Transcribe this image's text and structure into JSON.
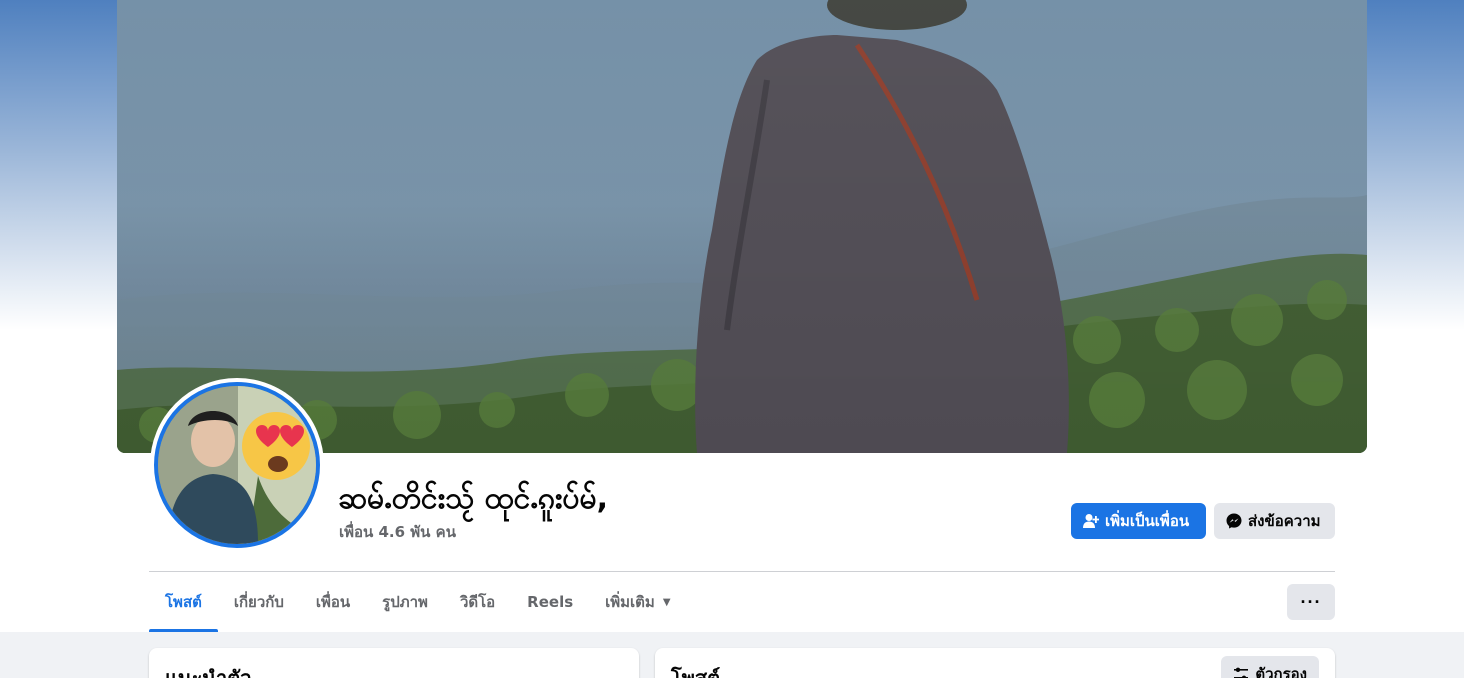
{
  "profile": {
    "name": "ဆမ်ႉတိင်းသႂ် ထုင်ႉၵူးပ်မ်,",
    "friends_count": "เพื่อน 4.6 พัน คน"
  },
  "actions": {
    "add_friend_label": "เพิ่มเป็นเพื่อน",
    "message_label": "ส่งข้อความ",
    "more_label": "···"
  },
  "tabs": [
    {
      "label": "โพสต์",
      "active": true
    },
    {
      "label": "เกี่ยวกับ",
      "active": false
    },
    {
      "label": "เพื่อน",
      "active": false
    },
    {
      "label": "รูปภาพ",
      "active": false
    },
    {
      "label": "วิดีโอ",
      "active": false
    },
    {
      "label": "Reels",
      "active": false
    },
    {
      "label": "เพิ่มเติม",
      "active": false,
      "dropdown": true
    }
  ],
  "intro_card": {
    "title": "แนะนำตัว"
  },
  "posts_card": {
    "title": "โพสต์",
    "filter_label": "ตัวกรอง"
  },
  "colors": {
    "accent": "#1b74e4",
    "secondary_button": "#e4e6eb",
    "page_bg": "#f0f2f5"
  }
}
